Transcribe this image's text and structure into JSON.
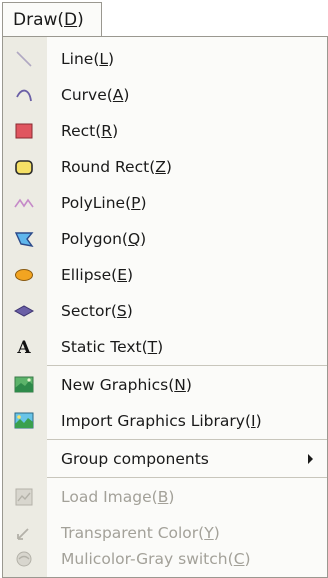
{
  "menu": {
    "title": "Draw",
    "title_key": "D"
  },
  "items": [
    {
      "name": "Line",
      "key": "L",
      "icon": "line-icon",
      "enabled": true
    },
    {
      "name": "Curve",
      "key": "A",
      "icon": "curve-icon",
      "enabled": true
    },
    {
      "name": "Rect",
      "key": "R",
      "icon": "rect-icon",
      "enabled": true
    },
    {
      "name": "Round Rect",
      "key": "Z",
      "icon": "round-rect-icon",
      "enabled": true
    },
    {
      "name": "PolyLine",
      "key": "P",
      "icon": "polyline-icon",
      "enabled": true
    },
    {
      "name": "Polygon",
      "key": "Q",
      "icon": "polygon-icon",
      "enabled": true
    },
    {
      "name": "Ellipse",
      "key": "E",
      "icon": "ellipse-icon",
      "enabled": true
    },
    {
      "name": "Sector",
      "key": "S",
      "icon": "sector-icon",
      "enabled": true
    },
    {
      "name": "Static Text",
      "key": "T",
      "icon": "static-text-icon",
      "enabled": true
    },
    {
      "name": "New Graphics",
      "key": "N",
      "icon": "new-graphics-icon",
      "enabled": true
    },
    {
      "name": "Import Graphics Library",
      "key": "I",
      "icon": "import-graphics-library-icon",
      "enabled": true
    },
    {
      "name": "Group components",
      "key": "",
      "icon": "",
      "enabled": true,
      "submenu": true
    },
    {
      "name": "Load Image",
      "key": "B",
      "icon": "load-image-icon",
      "enabled": false
    },
    {
      "name": "Transparent Color",
      "key": "Y",
      "icon": "transparent-color-icon",
      "enabled": false
    },
    {
      "name": "Mulicolor-Gray switch",
      "key": "C",
      "icon": "multicolor-gray-switch-icon",
      "enabled": false
    }
  ],
  "colors": {
    "rect_fill": "#e0555f",
    "round_rect_fill": "#f5e066",
    "polygon_fill": "#5fb6ec",
    "ellipse_fill": "#f2a421",
    "sector_fill": "#6a5fa6",
    "polyline_stroke": "#c58ac8",
    "curve_stroke": "#6a5fa6",
    "line_stroke": "#b0a8c2",
    "disabled_text": "#a3a199"
  }
}
